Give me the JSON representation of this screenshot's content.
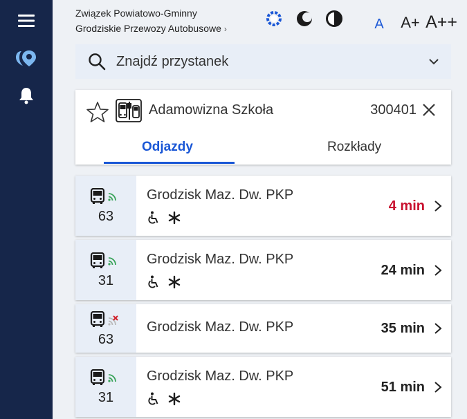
{
  "header": {
    "org_line1": "Związek Powiatowo-Gminny",
    "org_line2": "Grodziskie Przewozy Autobusowe",
    "org_chevron": "›",
    "font_small": "A",
    "font_medium": "A+",
    "font_large": "A++"
  },
  "sidebar": {
    "icons": [
      "menu-icon",
      "logo-icon",
      "bell-icon"
    ]
  },
  "search": {
    "label": "Znajdź przystanek"
  },
  "stop": {
    "name": "Adamowizna Szkoła",
    "id": "300401",
    "tabs": [
      {
        "label": "Odjazdy",
        "active": true
      },
      {
        "label": "Rozkłady",
        "active": false
      }
    ]
  },
  "departures": [
    {
      "line": "63",
      "destination": "Grodzisk Maz. Dw. PKP",
      "time": "4 min",
      "realtime": true,
      "accessible": true,
      "snow": true
    },
    {
      "line": "31",
      "destination": "Grodzisk Maz. Dw. PKP",
      "time": "24 min",
      "realtime": true,
      "accessible": true,
      "snow": true
    },
    {
      "line": "63",
      "destination": "Grodzisk Maz. Dw. PKP",
      "time": "35 min",
      "realtime": false,
      "accessible": false,
      "snow": false
    },
    {
      "line": "31",
      "destination": "Grodzisk Maz. Dw. PKP",
      "time": "51 min",
      "realtime": true,
      "accessible": true,
      "snow": true
    }
  ],
  "colors": {
    "sidebar": "#16264a",
    "accent": "#1a57d6",
    "soon": "#c8102e",
    "realtime": "#3aa35a",
    "no_realtime": "#d0202a"
  }
}
